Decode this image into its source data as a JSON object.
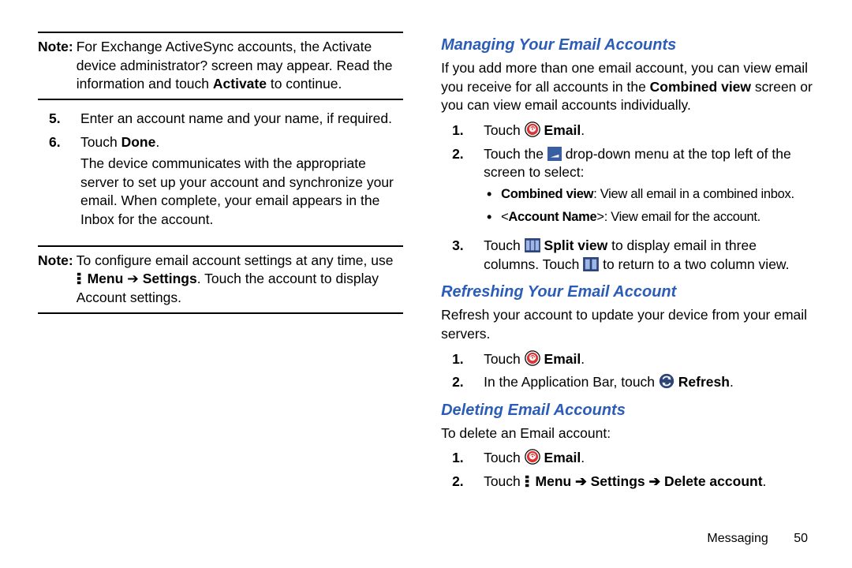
{
  "left": {
    "note1": {
      "label": "Note:",
      "text_a": "For Exchange ActiveSync accounts, the Activate device administrator? screen may appear. Read the information and touch ",
      "text_b": "Activate",
      "text_c": " to continue."
    },
    "step5": {
      "num": "5.",
      "text": "Enter an account name and your name, if required."
    },
    "step6": {
      "num": "6.",
      "a": "Touch ",
      "b": "Done",
      "c": ".",
      "para": "The device communicates with the appropriate server to set up your account and synchronize your email. When complete, your email appears in the Inbox for the account."
    },
    "note2": {
      "label": "Note:",
      "a": "To configure email account settings at any time, use ",
      "menu": "Menu",
      "arrow": " ➔ ",
      "settings": "Settings",
      "b": ". Touch the account to display Account settings."
    }
  },
  "right": {
    "h1": "Managing Your Email Accounts",
    "p1_a": "If you add more than one email account, you can view email you receive for all accounts in the ",
    "p1_b": "Combined view",
    "p1_c": " screen or you can view email accounts individually.",
    "m_step1": {
      "num": "1.",
      "a": "Touch ",
      "b": "Email",
      "c": "."
    },
    "m_step2": {
      "num": "2.",
      "a": "Touch the ",
      "b": " drop-down menu at the top left of the screen to select:"
    },
    "m_bul1": {
      "a": "Combined view",
      "b": ": View all email in a combined inbox."
    },
    "m_bul2": {
      "a": "Account Name",
      "b": ">: View email for the account."
    },
    "m_step3": {
      "num": "3.",
      "a": "Touch ",
      "b": "Split view",
      "c": " to display email in three columns. Touch ",
      "d": " to return to a two column view."
    },
    "h2": "Refreshing Your Email Account",
    "p2": "Refresh your account to update your device from your email servers.",
    "r_step1": {
      "num": "1.",
      "a": "Touch ",
      "b": "Email",
      "c": "."
    },
    "r_step2": {
      "num": "2.",
      "a": "In the Application Bar, touch ",
      "b": "Refresh",
      "c": "."
    },
    "h3": "Deleting Email Accounts",
    "p3": "To delete an Email account:",
    "d_step1": {
      "num": "1.",
      "a": "Touch ",
      "b": "Email",
      "c": "."
    },
    "d_step2": {
      "num": "2.",
      "a": "Touch ",
      "menu": "Menu",
      "arrow1": " ➔ ",
      "settings": "Settings",
      "arrow2": " ➔ ",
      "del": "Delete account",
      "c": "."
    }
  },
  "footer": {
    "section": "Messaging",
    "page": "50"
  }
}
